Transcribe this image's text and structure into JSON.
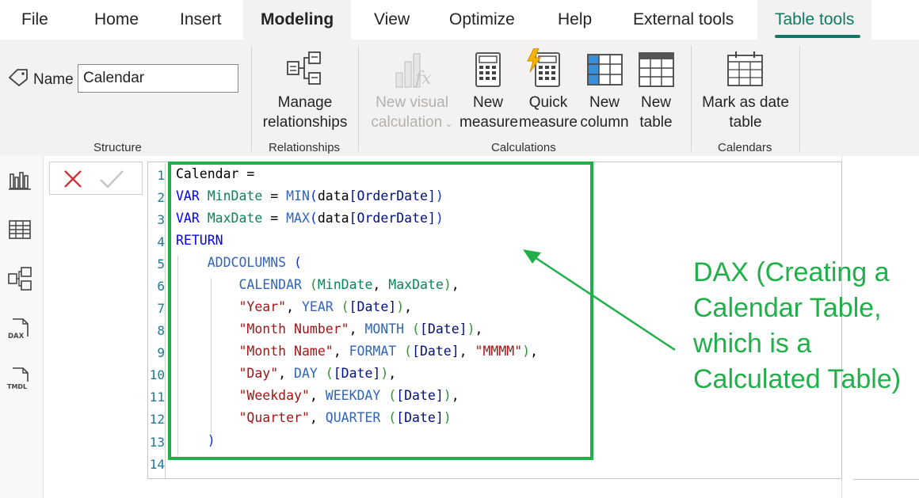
{
  "menu": {
    "file": "File",
    "home": "Home",
    "insert": "Insert",
    "modeling": "Modeling",
    "view": "View",
    "optimize": "Optimize",
    "help": "Help",
    "external_tools": "External tools",
    "table_tools": "Table tools"
  },
  "ribbon": {
    "structure": {
      "name_label": "Name",
      "name_value": "Calendar",
      "group_label": "Structure"
    },
    "relationships": {
      "manage_line1": "Manage",
      "manage_line2": "relationships",
      "group_label": "Relationships"
    },
    "calculations": {
      "new_visual_line1": "New visual",
      "new_visual_line2": "calculation",
      "new_measure_line1": "New",
      "new_measure_line2": "measure",
      "quick_measure_line1": "Quick",
      "quick_measure_line2": "measure",
      "new_column_line1": "New",
      "new_column_line2": "column",
      "new_table_line1": "New",
      "new_table_line2": "table",
      "group_label": "Calculations"
    },
    "calendars": {
      "mark_date_line1": "Mark as date",
      "mark_date_line2": "table",
      "group_label": "Calendars"
    }
  },
  "viewbar": {
    "report": "report-view-icon",
    "table": "table-view-icon",
    "model": "model-view-icon",
    "dax": "DAX",
    "tmdl": "TMDL"
  },
  "editor": {
    "line_numbers": [
      "1",
      "2",
      "3",
      "4",
      "5",
      "6",
      "7",
      "8",
      "9",
      "10",
      "11",
      "12",
      "13",
      "14"
    ],
    "l1": {
      "a": "Calendar ="
    },
    "l2": {
      "kw": "VAR",
      "v": "MinDate",
      "eq": " = ",
      "fn": "MIN",
      "o": "(",
      "t": "data",
      "c": "[OrderDate]",
      "cl": ")"
    },
    "l3": {
      "kw": "VAR",
      "v": "MaxDate",
      "eq": " = ",
      "fn": "MAX",
      "o": "(",
      "t": "data",
      "c": "[OrderDate]",
      "cl": ")"
    },
    "l4": {
      "kw": "RETURN"
    },
    "l5": {
      "fn": "ADDCOLUMNS",
      "o": " ("
    },
    "l6": {
      "fn": "CALENDAR",
      "o": " (",
      "a": "MinDate",
      "sep": ", ",
      "b": "MaxDate",
      "cl": "),",
      "tail": ""
    },
    "l7": {
      "s": "\"Year\"",
      "sep": ", ",
      "fn": "YEAR",
      "o": " (",
      "o2": "(",
      "c": "[Date]",
      "cl": "])",
      "end": "),"
    },
    "l8": {
      "s": "\"Month Number\"",
      "fn": "MONTH",
      "c": "[Date]"
    },
    "l9": {
      "s": "\"Month Name\"",
      "fn": "FORMAT",
      "c": "[Date]",
      "s2": "\"MMMM\""
    },
    "l10": {
      "s": "\"Day\"",
      "fn": "DAY",
      "c": "[Date]"
    },
    "l11": {
      "s": "\"Weekday\"",
      "fn": "WEEKDAY",
      "c": "[Date]"
    },
    "l12": {
      "s": "\"Quarter\"",
      "fn": "QUARTER",
      "c": "[Date]"
    },
    "l13": {
      "cl": ")"
    }
  },
  "annotation": {
    "text": "DAX (Creating a Calendar Table, which is a Calculated Table)"
  },
  "colors": {
    "accent_green": "#20b04a",
    "tab_green": "#117865",
    "keyword_blue": "#0000ff",
    "function_blue": "#3165bb",
    "string_red": "#a31515",
    "variable_green": "#098658"
  }
}
